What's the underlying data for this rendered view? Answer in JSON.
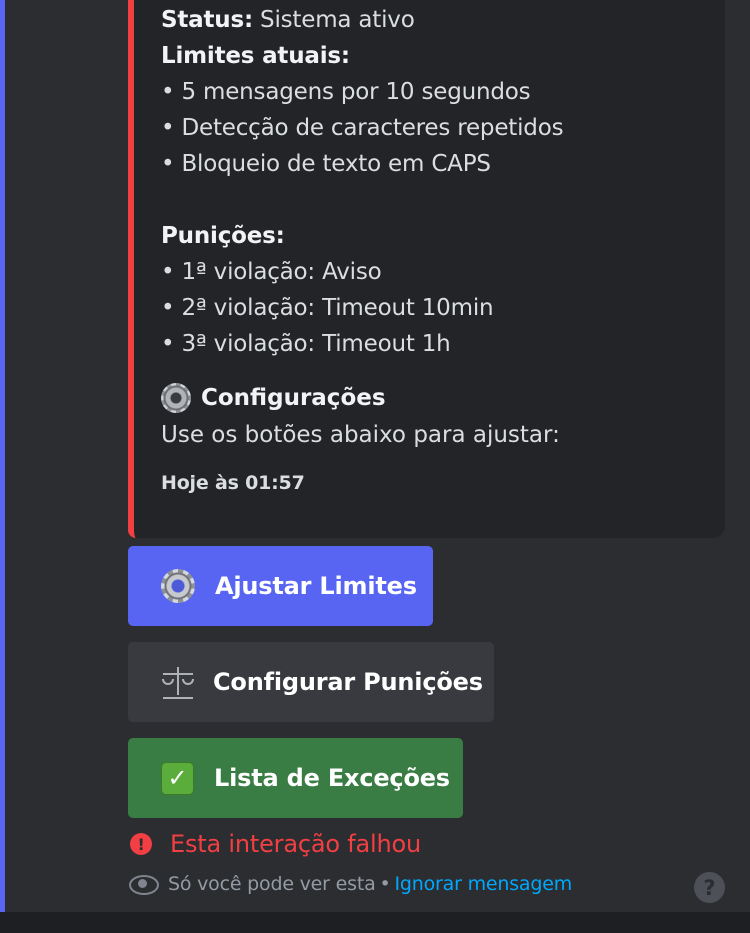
{
  "embed": {
    "status_label": "Status:",
    "status_value": " Sistema ativo",
    "limits_title": "Limites atuais:",
    "limits": [
      "• 5 mensagens por 10 segundos",
      "• Detecção de caracteres repetidos",
      "• Bloqueio de texto em CAPS"
    ],
    "punishments_title": "Punições:",
    "punishments": [
      "• 1ª violação: Aviso",
      "• 2ª violação: Timeout 10min",
      "• 3ª violação: Timeout 1h"
    ],
    "config_title": "Configurações",
    "config_text": "Use os botões abaixo para ajustar:",
    "timestamp": "Hoje às 01:57",
    "accent_color": "#f23f43"
  },
  "buttons": {
    "adjust_limits": "Ajustar Limites",
    "configure_punishments": "Configurar Punições",
    "exceptions_list": "Lista de Exceções"
  },
  "error": {
    "icon": "!",
    "text": "Esta interação falhou"
  },
  "notice": {
    "text": "Só você pode ver esta",
    "separator": "•",
    "dismiss_link": "Ignorar mensagem"
  },
  "help": {
    "icon": "?"
  },
  "icons": {
    "gear": "gear-icon",
    "scales": "scales-icon",
    "check": "check-mark-icon",
    "eye": "eye-icon",
    "error": "error-circle-icon",
    "help": "help-icon"
  },
  "colors": {
    "primary": "#5865f2",
    "secondary": "#383a40",
    "success": "#3a7d44",
    "danger": "#f23f43",
    "link": "#00a8fc"
  }
}
